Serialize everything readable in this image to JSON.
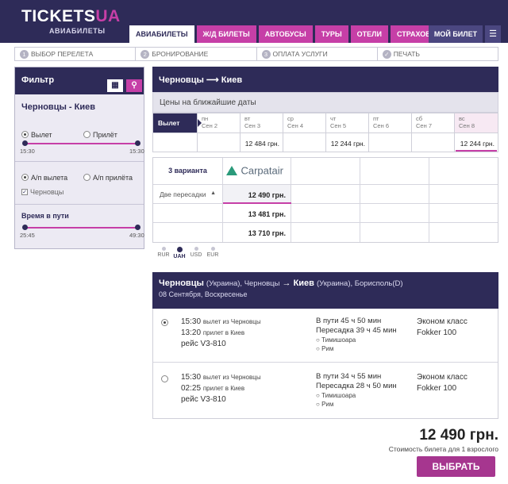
{
  "header": {
    "logo_main": "TICKETS",
    "logo_accent": "UA",
    "logo_sub": "АВИАБИЛЕТЫ",
    "tabs": [
      {
        "label": "АВИАБИЛЕТЫ",
        "active": true
      },
      {
        "label": "Ж/Д БИЛЕТЫ",
        "active": false
      },
      {
        "label": "АВТОБУСЫ",
        "active": false
      },
      {
        "label": "ТУРЫ",
        "active": false
      },
      {
        "label": "ОТЕЛИ",
        "active": false
      },
      {
        "label": "СТРАХОВКИ",
        "active": false
      }
    ],
    "my_ticket": "МОЙ БИЛЕТ",
    "colors": {
      "brand": "#2e2b58",
      "accent": "#c63fa7"
    }
  },
  "steps": [
    {
      "num": "1",
      "label": "ВЫБОР ПЕРЕЛЕТА"
    },
    {
      "num": "2",
      "label": "БРОНИРОВАНИЕ"
    },
    {
      "num": "3",
      "label": "ОПЛАТА УСЛУГИ"
    },
    {
      "num": "✓",
      "label": "ПЕЧАТЬ"
    }
  ],
  "filter": {
    "title": "Фильтр",
    "route": "Черновцы - Киев",
    "depart_label": "Вылет",
    "arrive_label": "Прилёт",
    "time_min": "15:30",
    "time_max": "15:30",
    "airport_dep_label": "А/п вылета",
    "airport_arr_label": "А/п прилёта",
    "airport_check": "Черновцы",
    "travel_time_label": "Время в пути",
    "travel_min": "25:45",
    "travel_max": "49:30"
  },
  "main": {
    "route_title": "Черновцы ⟶ Киев",
    "prices_title": "Цены на ближайшие даты",
    "depart_label": "Вылет",
    "dates": [
      {
        "dow": "пн",
        "date": "Сен 2",
        "price": ""
      },
      {
        "dow": "вт",
        "date": "Сен 3",
        "price": "12 484 грн."
      },
      {
        "dow": "ср",
        "date": "Сен 4",
        "price": ""
      },
      {
        "dow": "чт",
        "date": "Сен 5",
        "price": "12 244 грн."
      },
      {
        "dow": "пт",
        "date": "Сен 6",
        "price": ""
      },
      {
        "dow": "сб",
        "date": "Сен 7",
        "price": ""
      },
      {
        "dow": "вс",
        "date": "Сен 8",
        "price": "12 244 грн."
      }
    ],
    "variants_label": "3 варианта",
    "airline": "Carpatair",
    "stops_label": "Две пересадки",
    "variant_prices": [
      "12 490 грн.",
      "13 481 грн.",
      "13 710 грн."
    ],
    "currencies": [
      {
        "code": "RUR",
        "active": false
      },
      {
        "code": "UAH",
        "active": true
      },
      {
        "code": "USD",
        "active": false
      },
      {
        "code": "EUR",
        "active": false
      }
    ]
  },
  "route": {
    "from": "Черновцы",
    "from_country": "(Украина), Черновцы",
    "arrow": "→",
    "to": "Киев",
    "to_country": "(Украина), Борисполь(D)",
    "date": "08 Сентября, Воскресенье"
  },
  "flights": [
    {
      "selected": true,
      "dep_time": "15:30",
      "dep_text": "вылет из Черновцы",
      "arr_time": "13:20",
      "arr_text": "прилет в Киев",
      "flight_no": "рейс V3-810",
      "travel": "В пути 45 ч 50 мин",
      "transfer": "Пересадка 39 ч 45 мин",
      "stops": [
        "Тимишоара",
        "Рим"
      ],
      "class": "Эконом класс",
      "aircraft": "Fokker 100"
    },
    {
      "selected": false,
      "dep_time": "15:30",
      "dep_text": "вылет из Черновцы",
      "arr_time": "02:25",
      "arr_text": "прилет в Киев",
      "flight_no": "рейс V3-810",
      "travel": "В пути 34 ч 55 мин",
      "transfer": "Пересадка 28 ч 50 мин",
      "stops": [
        "Тимишоара",
        "Рим"
      ],
      "class": "Эконом класс",
      "aircraft": "Fokker 100"
    }
  ],
  "summary": {
    "total": "12 490 грн.",
    "note": "Стоимость билета для 1 взрослого",
    "select_button": "ВЫБРАТЬ"
  }
}
